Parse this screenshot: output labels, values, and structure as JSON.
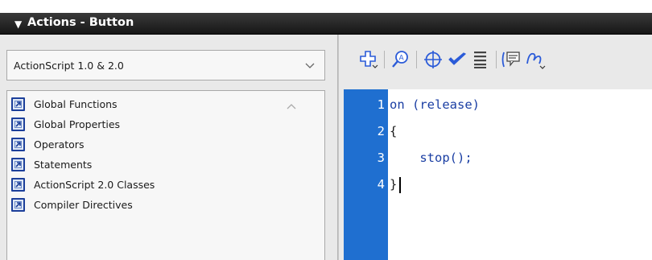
{
  "panel": {
    "title": "Actions - Button"
  },
  "left": {
    "version_dropdown": {
      "selected": "ActionScript 1.0 & 2.0"
    },
    "toolbox_items": [
      {
        "label": "Global Functions"
      },
      {
        "label": "Global Properties"
      },
      {
        "label": "Operators"
      },
      {
        "label": "Statements"
      },
      {
        "label": "ActionScript 2.0 Classes"
      },
      {
        "label": "Compiler Directives"
      }
    ]
  },
  "toolbar": {
    "icons": [
      "add-statement-icon",
      "find-icon",
      "insert-target-path-icon",
      "check-syntax-icon",
      "auto-format-icon",
      "show-code-hint-icon",
      "debug-options-icon"
    ]
  },
  "editor": {
    "line_numbers": [
      "1",
      "2",
      "3",
      "4"
    ],
    "lines": [
      {
        "keyword": "on",
        "rest": " (release)"
      },
      {
        "text": "{"
      },
      {
        "text": "    stop();"
      },
      {
        "text": "}"
      }
    ]
  },
  "colors": {
    "title_bar": "#1e1e1e",
    "gutter": "#1f6fd0",
    "keyword": "#1a3ea3",
    "icon_blue": "#2b5bd8"
  }
}
